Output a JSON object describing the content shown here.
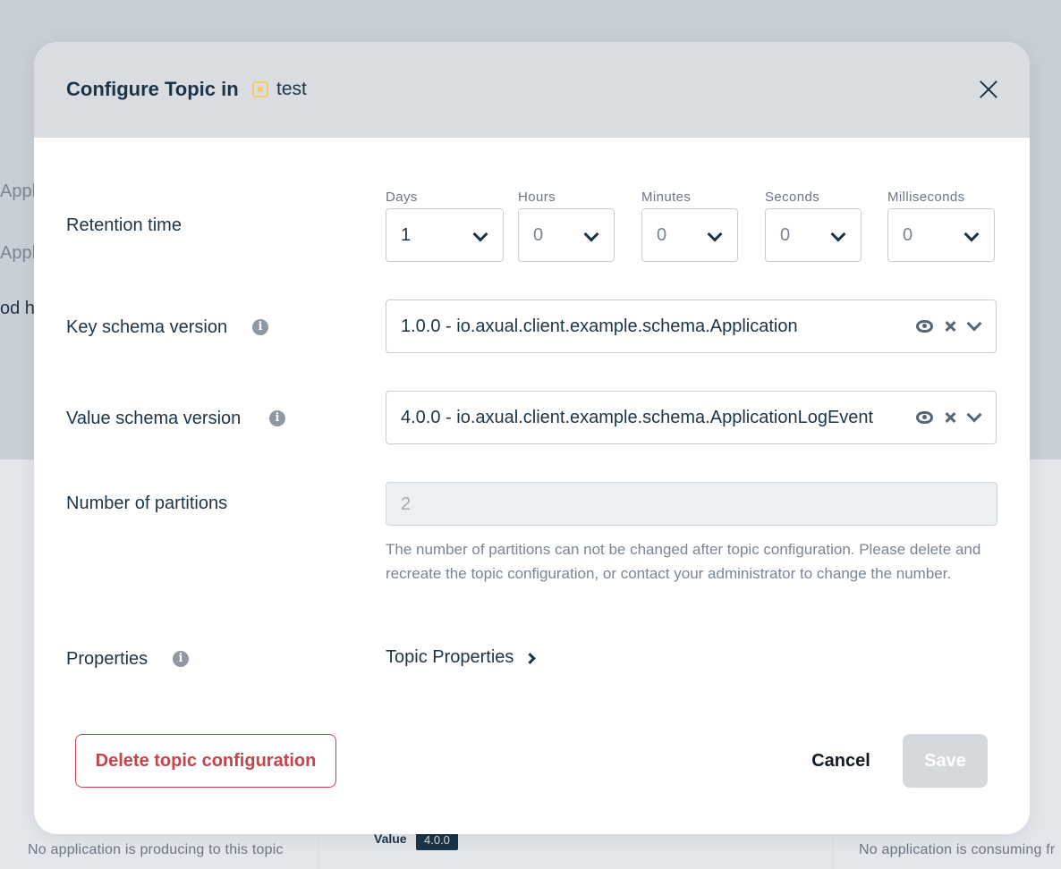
{
  "background": {
    "fragments": [
      "Appl",
      "Appl",
      "od h"
    ],
    "producing_text": "No application is producing to this topic",
    "value_label": "Value",
    "value_badge": "4.0.0",
    "consuming_text": "No application is consuming fr"
  },
  "modal": {
    "title": "Configure Topic in",
    "environment": "test",
    "retention": {
      "label": "Retention time",
      "fields": [
        {
          "label": "Days",
          "value": "1"
        },
        {
          "label": "Hours",
          "value": "0"
        },
        {
          "label": "Minutes",
          "value": "0"
        },
        {
          "label": "Seconds",
          "value": "0"
        },
        {
          "label": "Milliseconds",
          "value": "0"
        }
      ]
    },
    "key_schema": {
      "label": "Key schema version",
      "value": "1.0.0 - io.axual.client.example.schema.Application"
    },
    "value_schema": {
      "label": "Value schema version",
      "value": "4.0.0 - io.axual.client.example.schema.ApplicationLogEvent"
    },
    "partitions": {
      "label": "Number of partitions",
      "value": "2",
      "help": "The number of partitions can not be changed after topic configuration. Please delete and recreate the topic configuration, or contact your administrator to change the number."
    },
    "properties": {
      "label": "Properties",
      "link": "Topic Properties"
    },
    "buttons": {
      "delete": "Delete topic configuration",
      "cancel": "Cancel",
      "save": "Save"
    }
  },
  "colors": {
    "primary_text": "#1c3447",
    "danger": "#c8424a",
    "environment_icon": "#f2cc6a",
    "save_disabled": "#d5d9de"
  }
}
